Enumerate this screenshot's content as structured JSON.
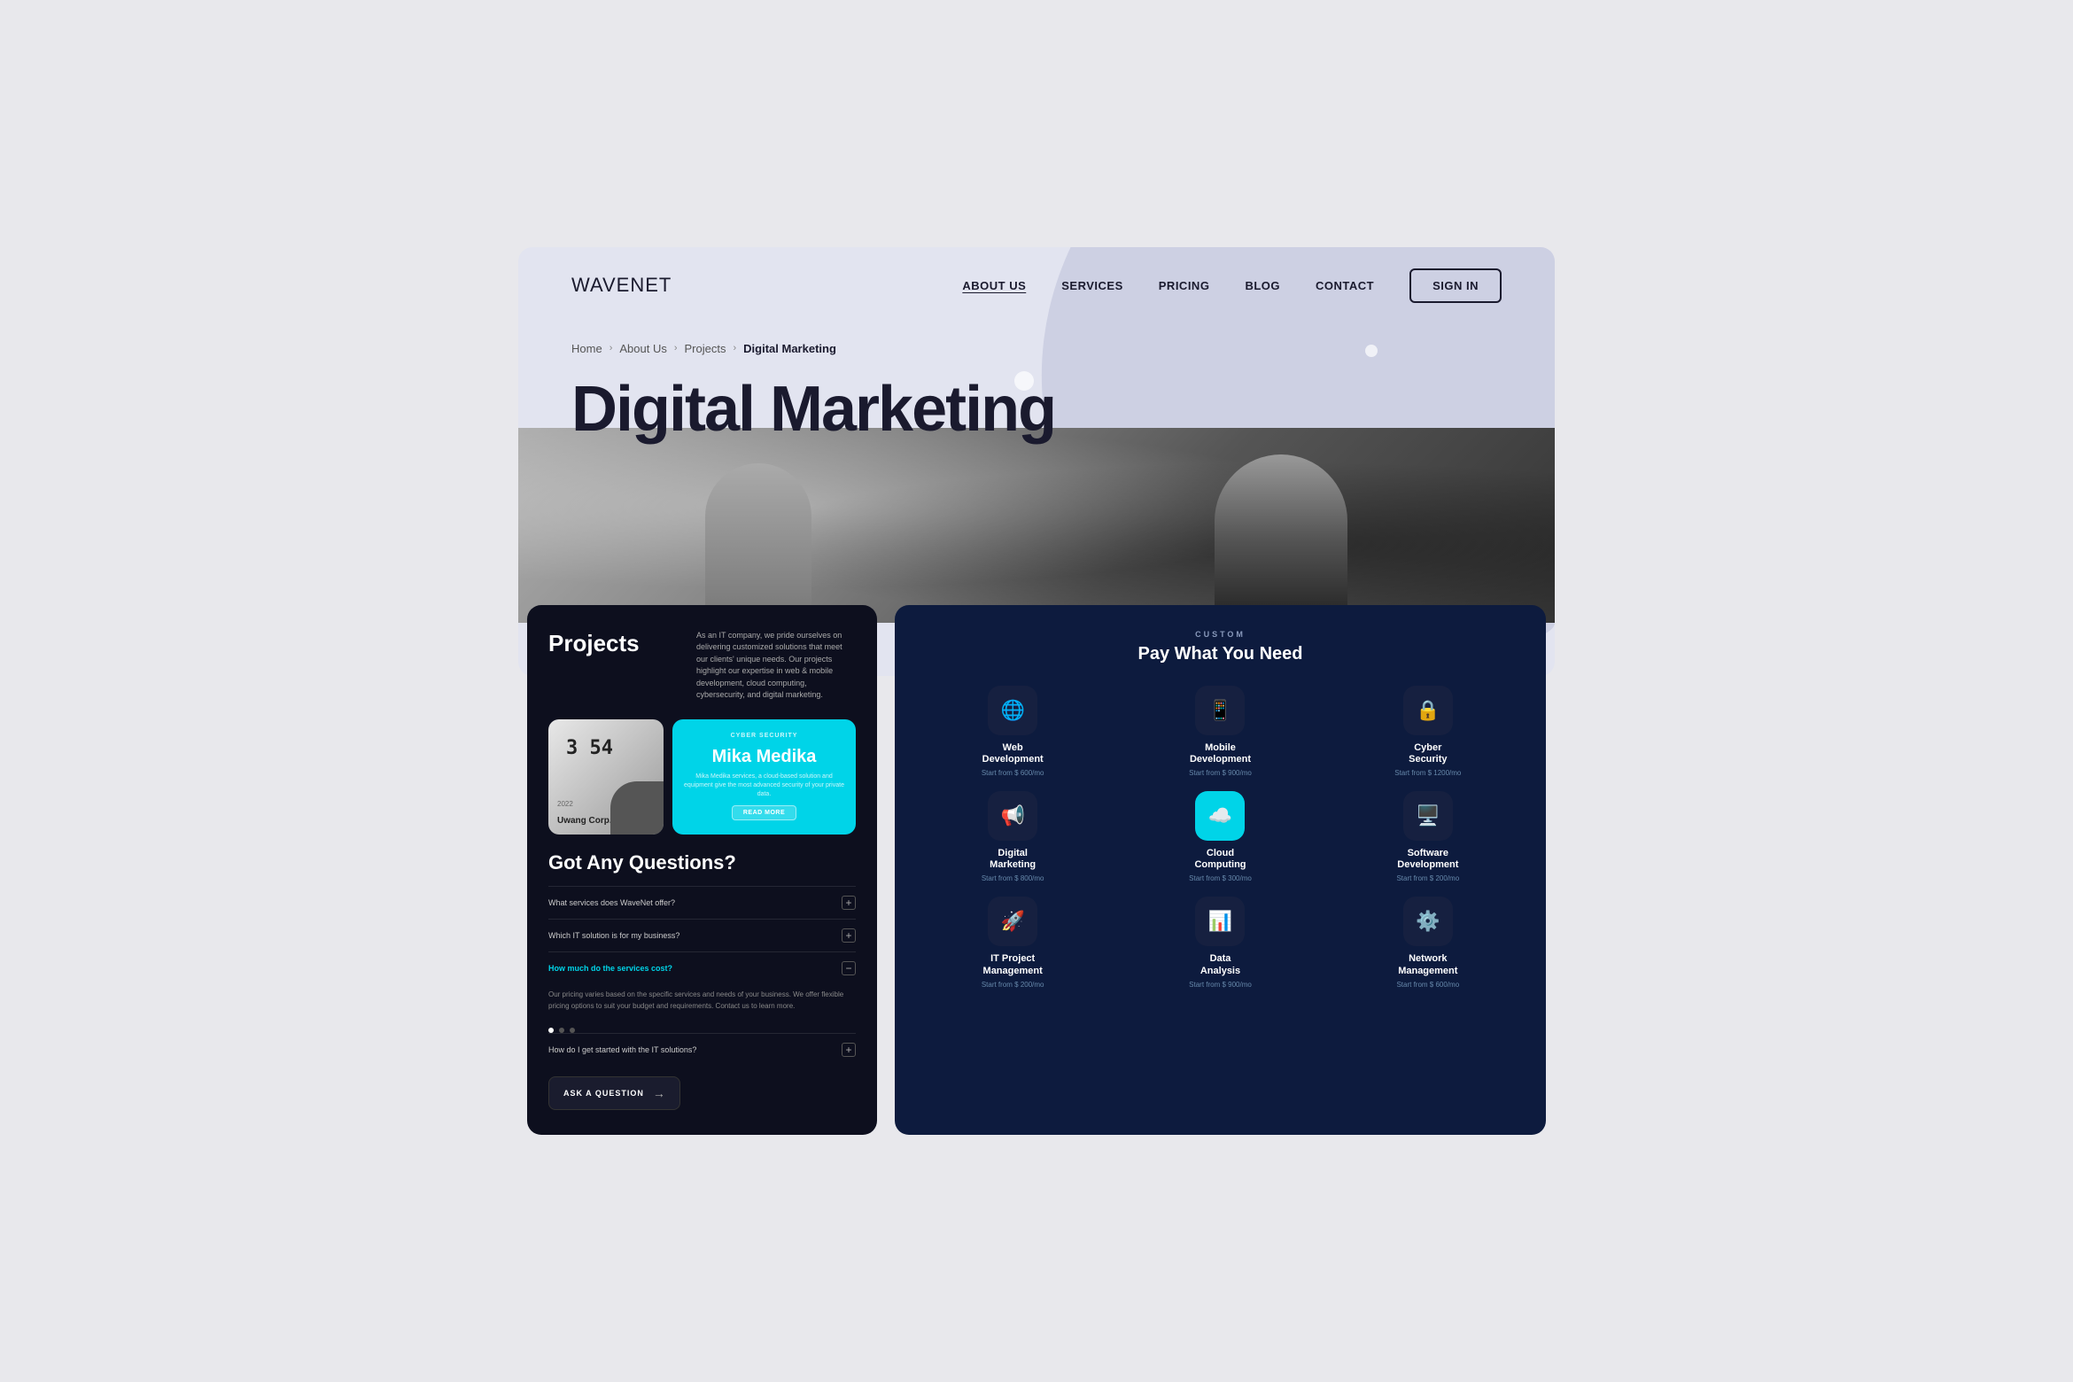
{
  "brand": {
    "name_bold": "WAVE",
    "name_light": "NET"
  },
  "nav": {
    "links": [
      {
        "label": "ABOUT US",
        "active": true
      },
      {
        "label": "SERVICES",
        "active": false
      },
      {
        "label": "PRICING",
        "active": false
      },
      {
        "label": "BLOG",
        "active": false
      },
      {
        "label": "CONTACT",
        "active": false
      }
    ],
    "sign_in": "SIGN IN"
  },
  "breadcrumb": {
    "items": [
      "Home",
      "About Us",
      "Projects",
      "Digital Marketing"
    ]
  },
  "page_title": "Digital Marketing",
  "left_card": {
    "projects_title": "Projects",
    "projects_desc": "As an IT company, we pride ourselves on delivering customized solutions that meet our clients' unique needs. Our projects highlight our expertise in web & mobile development, cloud computing, cybersecurity, and digital marketing.",
    "project_left": {
      "year": "2022",
      "name": "Uwang Corp."
    },
    "project_right": {
      "tag": "CYBER SECURITY",
      "name": "Mika Medika",
      "desc": "Mika Medika services, a cloud-based solution and equipment give the most advanced security of your private data.",
      "btn": "READ MORE"
    },
    "faq_title": "Got Any Questions?",
    "faq_items": [
      {
        "question": "What services does WaveNet offer?",
        "toggle": "+",
        "open": false
      },
      {
        "question": "Which IT solution is for my business?",
        "toggle": "+",
        "open": false
      },
      {
        "question": "How much do the services cost?",
        "toggle": "−",
        "open": true
      },
      {
        "question": "How do I get started with the IT solutions?",
        "toggle": "+",
        "open": false
      }
    ],
    "faq_answer": "Our pricing varies based on the specific services and needs of your business. We offer flexible pricing options to suit your budget and requirements. Contact us to learn more.",
    "ask_btn": "ASK A QUESTION"
  },
  "right_card": {
    "custom_label": "CUSTOM",
    "pay_title": "Pay What You Need",
    "services": [
      {
        "name": "Web\nDevelopment",
        "price": "Start from $ 600/mo",
        "icon": "🌐",
        "highlight": false
      },
      {
        "name": "Mobile\nDevelopment",
        "price": "Start from $ 900/mo",
        "icon": "📱",
        "highlight": false
      },
      {
        "name": "Cyber\nSecurity",
        "price": "Start from $ 1200/mo",
        "icon": "🔒",
        "highlight": false
      },
      {
        "name": "Digital\nMarketing",
        "price": "Start from $ 800/mo",
        "icon": "📢",
        "highlight": false
      },
      {
        "name": "Cloud\nComputing",
        "price": "Start from $ 300/mo",
        "icon": "☁️",
        "highlight": true
      },
      {
        "name": "Software\nDevelopment",
        "price": "Start from $ 200/mo",
        "icon": "🖥",
        "highlight": false
      },
      {
        "name": "IT Project\nManagement",
        "price": "Start from $ 200/mo",
        "icon": "🚀",
        "highlight": false
      },
      {
        "name": "Data\nAnalysis",
        "price": "Start from $ 900/mo",
        "icon": "📊",
        "highlight": false
      },
      {
        "name": "Network\nManagement",
        "price": "Start from $ 600/mo",
        "icon": "⚙️",
        "highlight": false
      }
    ]
  }
}
